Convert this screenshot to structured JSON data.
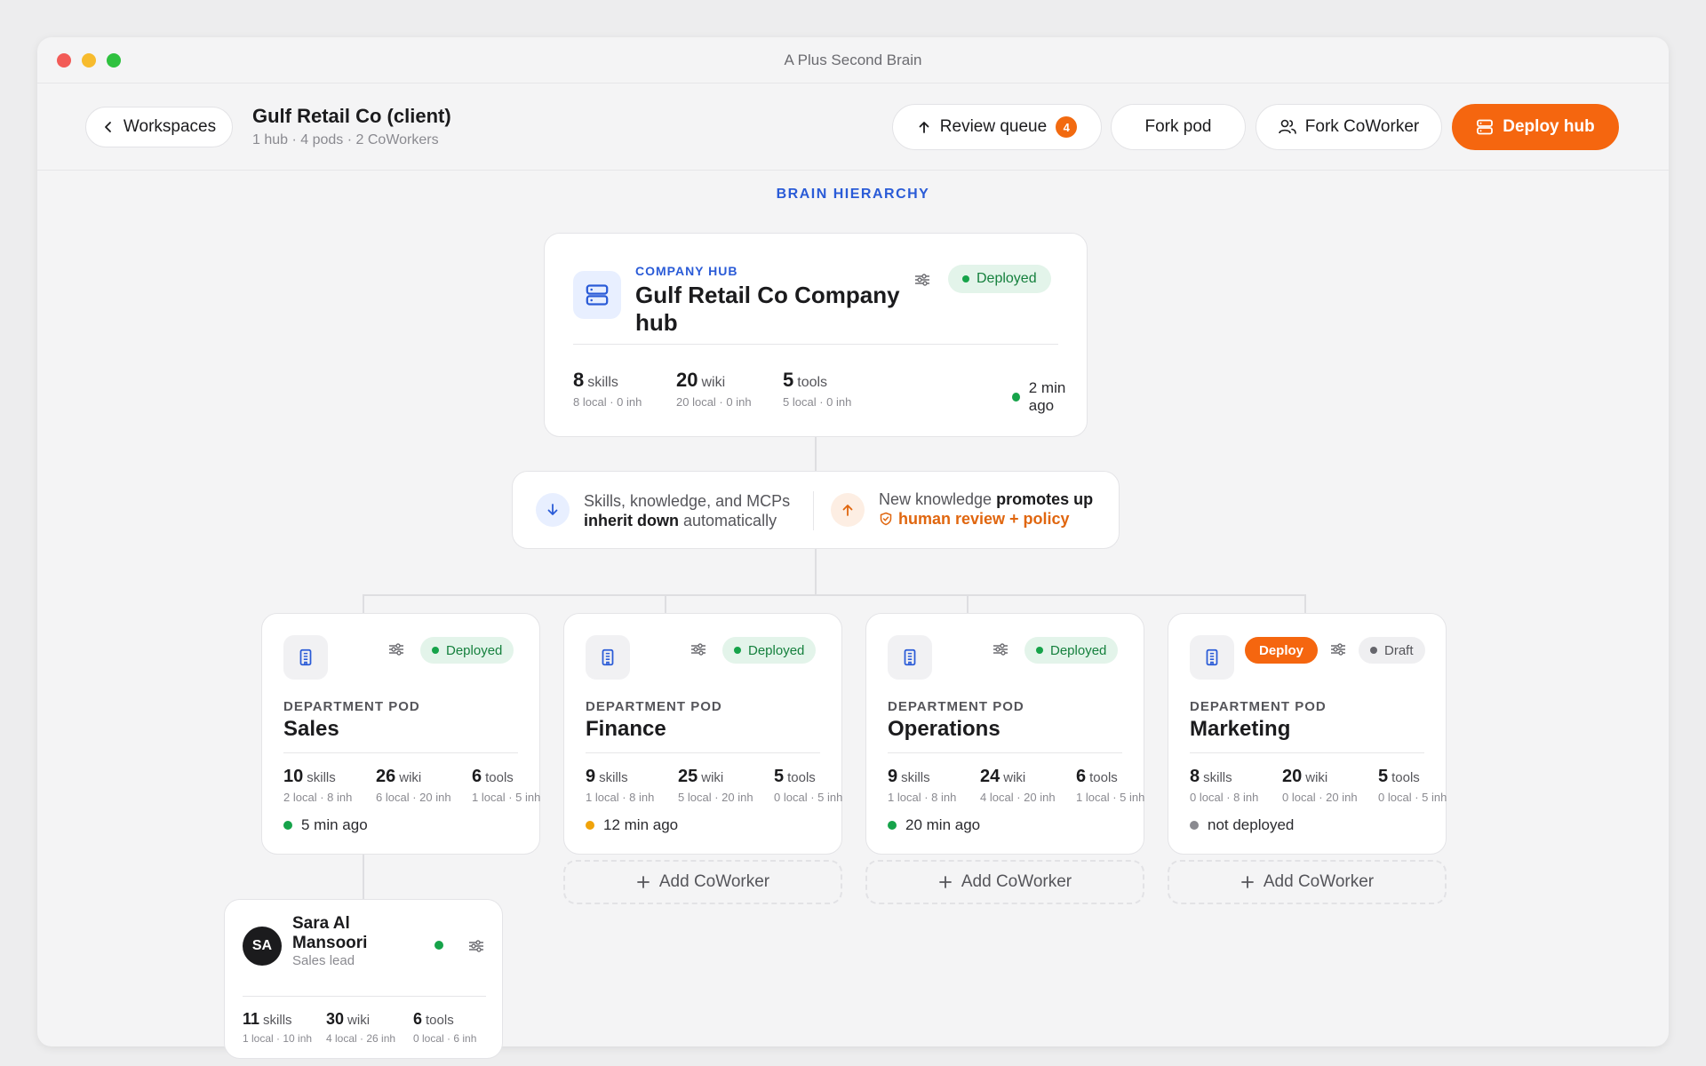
{
  "window": {
    "title": "A Plus Second Brain"
  },
  "header": {
    "back_label": "Workspaces",
    "workspace_title": "Gulf Retail Co (client)",
    "workspace_sub": "1 hub · 4 pods · 2 CoWorkers",
    "review_label": "Review queue",
    "review_count": "4",
    "fork_pod_label": "Fork pod",
    "fork_coworker_label": "Fork CoWorker",
    "deploy_hub_label": "Deploy hub"
  },
  "section_label": "BRAIN HIERARCHY",
  "hub": {
    "eyebrow": "COMPANY HUB",
    "name": "Gulf Retail Co Company hub",
    "status": "Deployed",
    "stats": [
      {
        "num": "8",
        "unit": "skills",
        "sub": "8 local · 0 inh"
      },
      {
        "num": "20",
        "unit": "wiki",
        "sub": "20 local · 0 inh"
      },
      {
        "num": "5",
        "unit": "tools",
        "sub": "5 local · 0 inh"
      }
    ],
    "updated": "2 min ago"
  },
  "flow": {
    "down_pre": "Skills, knowledge, and MCPs",
    "down_bold": "inherit down",
    "down_post": "automatically",
    "up_pre": "New knowledge",
    "up_bold": "promotes up",
    "up_policy": "human review + policy"
  },
  "pods": [
    {
      "eyebrow": "DEPARTMENT POD",
      "name": "Sales",
      "status": "Deployed",
      "stats": [
        {
          "num": "10",
          "unit": "skills",
          "sub": "2 local · 8 inh"
        },
        {
          "num": "26",
          "unit": "wiki",
          "sub": "6 local · 20 inh"
        },
        {
          "num": "6",
          "unit": "tools",
          "sub": "1 local · 5 inh"
        }
      ],
      "updated": "5 min ago",
      "dot_color": "#16a34a"
    },
    {
      "eyebrow": "DEPARTMENT POD",
      "name": "Finance",
      "status": "Deployed",
      "stats": [
        {
          "num": "9",
          "unit": "skills",
          "sub": "1 local · 8 inh"
        },
        {
          "num": "25",
          "unit": "wiki",
          "sub": "5 local · 20 inh"
        },
        {
          "num": "5",
          "unit": "tools",
          "sub": "0 local · 5 inh"
        }
      ],
      "updated": "12 min ago",
      "dot_color": "#f0a30a"
    },
    {
      "eyebrow": "DEPARTMENT POD",
      "name": "Operations",
      "status": "Deployed",
      "stats": [
        {
          "num": "9",
          "unit": "skills",
          "sub": "1 local · 8 inh"
        },
        {
          "num": "24",
          "unit": "wiki",
          "sub": "4 local · 20 inh"
        },
        {
          "num": "6",
          "unit": "tools",
          "sub": "1 local · 5 inh"
        }
      ],
      "updated": "20 min ago",
      "dot_color": "#16a34a"
    },
    {
      "eyebrow": "DEPARTMENT POD",
      "name": "Marketing",
      "status": "Draft",
      "deploy_label": "Deploy",
      "stats": [
        {
          "num": "8",
          "unit": "skills",
          "sub": "0 local · 8 inh"
        },
        {
          "num": "20",
          "unit": "wiki",
          "sub": "0 local · 20 inh"
        },
        {
          "num": "5",
          "unit": "tools",
          "sub": "0 local · 5 inh"
        }
      ],
      "updated": "not deployed",
      "dot_color": "#8a8a90"
    }
  ],
  "add_coworker_label": "Add CoWorker",
  "coworker": {
    "initials": "SA",
    "name": "Sara Al Mansoori",
    "role": "Sales lead",
    "status_color": "#16a34a",
    "stats": [
      {
        "num": "11",
        "unit": "skills",
        "sub": "1 local · 10 inh"
      },
      {
        "num": "30",
        "unit": "wiki",
        "sub": "4 local · 26 inh"
      },
      {
        "num": "6",
        "unit": "tools",
        "sub": "0 local · 6 inh"
      }
    ]
  },
  "colors": {
    "accent": "#f5660f",
    "brand_blue": "#2a5bd7",
    "deployed_green": "#16a34a"
  }
}
